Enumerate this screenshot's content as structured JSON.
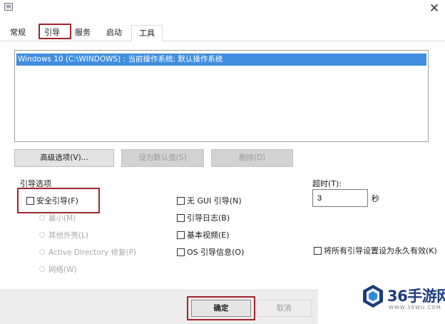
{
  "tabs": [
    {
      "label": "常规",
      "active": false
    },
    {
      "label": "引导",
      "active": true
    },
    {
      "label": "服务",
      "active": false
    },
    {
      "label": "启动",
      "active": false
    },
    {
      "label": "工具",
      "active": false
    }
  ],
  "os_list": {
    "items": [
      "Windows 10 (C:\\WINDOWS) : 当前操作系统; 默认操作系统"
    ]
  },
  "buttons": {
    "advanced": "高级选项(V)...",
    "set_default": "设为默认值(S)",
    "delete": "删除(D)"
  },
  "boot_options": {
    "label": "引导选项",
    "safe_boot": "安全引导(F)",
    "minimal": "最小(M)",
    "alternate_shell": "其他外壳(L)",
    "active_directory": "Active Directory 修复(P)",
    "network": "网络(W)",
    "no_gui": "无 GUI 引导(N)",
    "boot_log": "引导日志(B)",
    "base_video": "基本视频(E)",
    "os_info": "OS 引导信息(O)"
  },
  "timeout": {
    "label": "超时(T):",
    "value": "3",
    "unit": "秒"
  },
  "make_permanent": "将所有引导设置设为永久有效(K)",
  "footer": {
    "ok": "确定",
    "cancel": "取消"
  },
  "watermark": {
    "title": "36手游网",
    "url": "WWW.36WU.COM"
  },
  "colors": {
    "selection": "#3f8ee0",
    "highlight_box": "#a1242c",
    "watermark_blue": "#1d3c7e"
  }
}
